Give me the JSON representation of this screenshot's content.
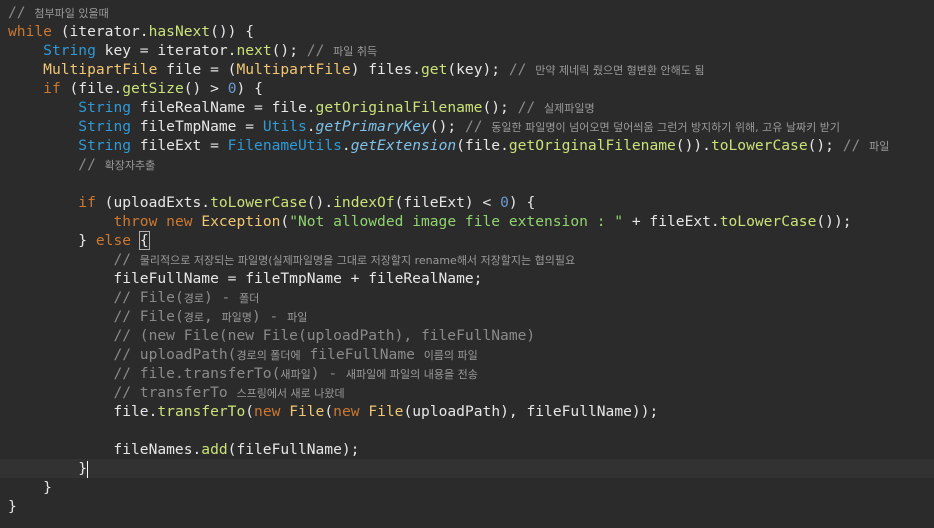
{
  "editor": {
    "colors": {
      "background": "#2b2b2b",
      "current_line": "#323232",
      "keyword": "#cc7832",
      "type": "#2f9ad6",
      "class": "#f0c674",
      "method": "#c9e279",
      "string": "#8fd46f",
      "comment": "#8a8a8a",
      "number": "#6b9bd2"
    },
    "lines": [
      [
        {
          "c": "cmt",
          "t": "// "
        },
        {
          "c": "cmt-kr",
          "t": "첨부파일 있을때"
        }
      ],
      [
        {
          "c": "kw",
          "t": "while"
        },
        {
          "c": "plain",
          "t": " (iterator."
        },
        {
          "c": "method",
          "t": "hasNext"
        },
        {
          "c": "plain",
          "t": "()) {"
        }
      ],
      [
        {
          "c": "plain",
          "t": "    "
        },
        {
          "c": "type",
          "t": "String"
        },
        {
          "c": "plain",
          "t": " key = iterator."
        },
        {
          "c": "method",
          "t": "next"
        },
        {
          "c": "plain",
          "t": "(); "
        },
        {
          "c": "cmt",
          "t": "// "
        },
        {
          "c": "cmt-kr",
          "t": "파일 취득"
        }
      ],
      [
        {
          "c": "plain",
          "t": "    "
        },
        {
          "c": "cls",
          "t": "MultipartFile"
        },
        {
          "c": "plain",
          "t": " file = ("
        },
        {
          "c": "cls",
          "t": "MultipartFile"
        },
        {
          "c": "plain",
          "t": ") files."
        },
        {
          "c": "method",
          "t": "get"
        },
        {
          "c": "plain",
          "t": "(key); "
        },
        {
          "c": "cmt",
          "t": "// "
        },
        {
          "c": "cmt-kr",
          "t": "만약 제네릭 줬으면 형변환 안해도 됨"
        }
      ],
      [
        {
          "c": "plain",
          "t": "    "
        },
        {
          "c": "kw",
          "t": "if"
        },
        {
          "c": "plain",
          "t": " (file."
        },
        {
          "c": "method",
          "t": "getSize"
        },
        {
          "c": "plain",
          "t": "() > "
        },
        {
          "c": "num",
          "t": "0"
        },
        {
          "c": "plain",
          "t": ") {"
        }
      ],
      [
        {
          "c": "plain",
          "t": "        "
        },
        {
          "c": "type",
          "t": "String"
        },
        {
          "c": "plain",
          "t": " fileRealName = file."
        },
        {
          "c": "method",
          "t": "getOriginalFilename"
        },
        {
          "c": "plain",
          "t": "(); "
        },
        {
          "c": "cmt",
          "t": "// "
        },
        {
          "c": "cmt-kr",
          "t": "실제파일명"
        }
      ],
      [
        {
          "c": "plain",
          "t": "        "
        },
        {
          "c": "type",
          "t": "String"
        },
        {
          "c": "plain",
          "t": " fileTmpName = "
        },
        {
          "c": "type",
          "t": "Utils"
        },
        {
          "c": "plain",
          "t": "."
        },
        {
          "c": "static",
          "t": "getPrimaryKey"
        },
        {
          "c": "plain",
          "t": "(); "
        },
        {
          "c": "cmt",
          "t": "// "
        },
        {
          "c": "cmt-kr",
          "t": "동일한 파일명이 넘어오면 덮어씌움 그런거 방지하기 위해, 고유 날짜키 받기"
        }
      ],
      [
        {
          "c": "plain",
          "t": "        "
        },
        {
          "c": "type",
          "t": "String"
        },
        {
          "c": "plain",
          "t": " fileExt = "
        },
        {
          "c": "type",
          "t": "FilenameUtils"
        },
        {
          "c": "plain",
          "t": "."
        },
        {
          "c": "static",
          "t": "getExtension"
        },
        {
          "c": "plain",
          "t": "(file."
        },
        {
          "c": "method",
          "t": "getOriginalFilename"
        },
        {
          "c": "plain",
          "t": "())."
        },
        {
          "c": "method",
          "t": "toLowerCase"
        },
        {
          "c": "plain",
          "t": "(); "
        },
        {
          "c": "cmt",
          "t": "// "
        },
        {
          "c": "cmt-kr",
          "t": "파일"
        }
      ],
      [
        {
          "c": "plain",
          "t": "        "
        },
        {
          "c": "cmt",
          "t": "// "
        },
        {
          "c": "cmt-kr",
          "t": "확장자추출"
        }
      ],
      [],
      [
        {
          "c": "plain",
          "t": "        "
        },
        {
          "c": "kw",
          "t": "if"
        },
        {
          "c": "plain",
          "t": " (uploadExts."
        },
        {
          "c": "method",
          "t": "toLowerCase"
        },
        {
          "c": "plain",
          "t": "()."
        },
        {
          "c": "method",
          "t": "indexOf"
        },
        {
          "c": "plain",
          "t": "(fileExt) < "
        },
        {
          "c": "num",
          "t": "0"
        },
        {
          "c": "plain",
          "t": ") {"
        }
      ],
      [
        {
          "c": "plain",
          "t": "            "
        },
        {
          "c": "kw",
          "t": "throw new"
        },
        {
          "c": "plain",
          "t": " "
        },
        {
          "c": "cls",
          "t": "Exception"
        },
        {
          "c": "plain",
          "t": "("
        },
        {
          "c": "str",
          "t": "\"Not allowded image file extension : \""
        },
        {
          "c": "plain",
          "t": " + fileExt."
        },
        {
          "c": "method",
          "t": "toLowerCase"
        },
        {
          "c": "plain",
          "t": "());"
        }
      ],
      [
        {
          "c": "plain",
          "t": "        } "
        },
        {
          "c": "kw",
          "t": "else"
        },
        {
          "c": "plain",
          "t": " "
        },
        {
          "c": "brace-hl",
          "t": "{"
        }
      ],
      [
        {
          "c": "plain",
          "t": "            "
        },
        {
          "c": "cmt",
          "t": "// "
        },
        {
          "c": "cmt-kr",
          "t": "물리적으로 저장되는 파일명(실제파일명을 그대로 저장할지 rename해서 저장할지는 협의필요"
        }
      ],
      [
        {
          "c": "plain",
          "t": "            fileFullName = fileTmpName + fileRealName;"
        }
      ],
      [
        {
          "c": "plain",
          "t": "            "
        },
        {
          "c": "cmt",
          "t": "// File("
        },
        {
          "c": "cmt-kr",
          "t": "경로"
        },
        {
          "c": "cmt",
          "t": ") - "
        },
        {
          "c": "cmt-kr",
          "t": "폴더"
        }
      ],
      [
        {
          "c": "plain",
          "t": "            "
        },
        {
          "c": "cmt",
          "t": "// File("
        },
        {
          "c": "cmt-kr",
          "t": "경로"
        },
        {
          "c": "cmt",
          "t": ", "
        },
        {
          "c": "cmt-kr",
          "t": "파일명"
        },
        {
          "c": "cmt",
          "t": ") - "
        },
        {
          "c": "cmt-kr",
          "t": "파일"
        }
      ],
      [
        {
          "c": "plain",
          "t": "            "
        },
        {
          "c": "cmt",
          "t": "// (new File(new File(uploadPath), fileFullName)"
        }
      ],
      [
        {
          "c": "plain",
          "t": "            "
        },
        {
          "c": "cmt",
          "t": "// uploadPath("
        },
        {
          "c": "cmt-kr",
          "t": "경로의 폴더에"
        },
        {
          "c": "cmt",
          "t": " fileFullName "
        },
        {
          "c": "cmt-kr",
          "t": "이름의 파일"
        }
      ],
      [
        {
          "c": "plain",
          "t": "            "
        },
        {
          "c": "cmt",
          "t": "// file.transferTo("
        },
        {
          "c": "cmt-kr",
          "t": "새파일"
        },
        {
          "c": "cmt",
          "t": ") - "
        },
        {
          "c": "cmt-kr",
          "t": "새파일에 파일의 내용을 전송"
        }
      ],
      [
        {
          "c": "plain",
          "t": "            "
        },
        {
          "c": "cmt",
          "t": "// transferTo "
        },
        {
          "c": "cmt-kr",
          "t": "스프링에서 새로 나왔데"
        }
      ],
      [
        {
          "c": "plain",
          "t": "            file."
        },
        {
          "c": "method",
          "t": "transferTo"
        },
        {
          "c": "plain",
          "t": "("
        },
        {
          "c": "kw",
          "t": "new"
        },
        {
          "c": "plain",
          "t": " "
        },
        {
          "c": "cls",
          "t": "File"
        },
        {
          "c": "plain",
          "t": "("
        },
        {
          "c": "kw",
          "t": "new"
        },
        {
          "c": "plain",
          "t": " "
        },
        {
          "c": "cls",
          "t": "File"
        },
        {
          "c": "plain",
          "t": "(uploadPath), fileFullName));"
        }
      ],
      [],
      [
        {
          "c": "plain",
          "t": "            fileNames."
        },
        {
          "c": "method",
          "t": "add"
        },
        {
          "c": "plain",
          "t": "(fileFullName);"
        }
      ],
      [
        {
          "c": "plain",
          "t": "        }"
        }
      ],
      [
        {
          "c": "plain",
          "t": "    }"
        }
      ],
      [
        {
          "c": "plain",
          "t": "}"
        }
      ]
    ]
  }
}
